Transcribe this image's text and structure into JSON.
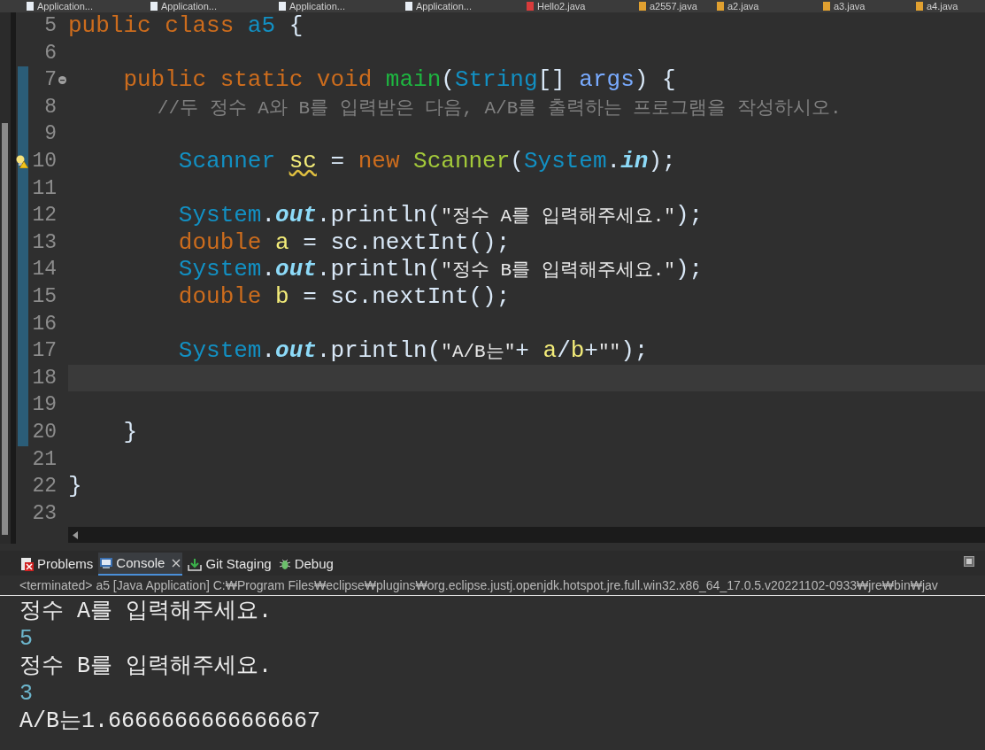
{
  "editor_tabs": [
    {
      "label": "Application...",
      "kind": "app"
    },
    {
      "label": "Application...",
      "kind": "app"
    },
    {
      "label": "Application...",
      "kind": "app"
    },
    {
      "label": "Application...",
      "kind": "app"
    },
    {
      "label": "Hello2.java",
      "kind": "error"
    },
    {
      "label": "a2557.java",
      "kind": "warning"
    },
    {
      "label": "a2.java",
      "kind": "warning"
    },
    {
      "label": "a3.java",
      "kind": "warning"
    },
    {
      "label": "a4.java",
      "kind": "warning"
    }
  ],
  "editor": {
    "lines": [
      {
        "number": "5",
        "changed": false,
        "current": false,
        "fold": false,
        "warning": false,
        "tokens": [
          {
            "text": "public class ",
            "kind": "keyword"
          },
          {
            "text": "a5",
            "kind": "type"
          },
          {
            "text": " {",
            "kind": "plain"
          }
        ]
      },
      {
        "number": "6",
        "changed": false,
        "current": false,
        "fold": false,
        "warning": false
      },
      {
        "number": "7",
        "changed": true,
        "current": false,
        "fold": true,
        "warning": false,
        "tokens": [
          {
            "text": "    public static void ",
            "kind": "keyword"
          },
          {
            "text": "main",
            "kind": "method"
          },
          {
            "text": "(",
            "kind": "plain"
          },
          {
            "text": "String",
            "kind": "type"
          },
          {
            "text": "[] ",
            "kind": "plain"
          },
          {
            "text": "args",
            "kind": "param"
          },
          {
            "text": ") {",
            "kind": "plain"
          }
        ]
      },
      {
        "number": "8",
        "changed": true,
        "current": false,
        "fold": false,
        "warning": false,
        "tokens": [
          {
            "text": "        //두 정수 A와 B를 입력받은 다음, A/B를 출력하는 프로그램을 작성하시오.",
            "kind": "comment"
          }
        ]
      },
      {
        "number": "9",
        "changed": true,
        "current": false,
        "fold": false,
        "warning": false
      },
      {
        "number": "10",
        "changed": true,
        "current": false,
        "fold": false,
        "warning": true,
        "tokens": [
          {
            "text": "        Scanner ",
            "kind": "type"
          },
          {
            "text": "sc",
            "kind": "unused"
          },
          {
            "text": " = ",
            "kind": "plain"
          },
          {
            "text": "new ",
            "kind": "keyword"
          },
          {
            "text": "Scanner",
            "kind": "constructor"
          },
          {
            "text": "(",
            "kind": "plain"
          },
          {
            "text": "System",
            "kind": "type"
          },
          {
            "text": ".",
            "kind": "plain"
          },
          {
            "text": "in",
            "kind": "static"
          },
          {
            "text": ");",
            "kind": "plain"
          }
        ]
      },
      {
        "number": "11",
        "changed": true,
        "current": false,
        "fold": false,
        "warning": false
      },
      {
        "number": "12",
        "changed": true,
        "current": false,
        "fold": false,
        "warning": false,
        "tokens": [
          {
            "text": "        System",
            "kind": "type"
          },
          {
            "text": ".",
            "kind": "plain"
          },
          {
            "text": "out",
            "kind": "static"
          },
          {
            "text": ".println(",
            "kind": "plain"
          },
          {
            "text": "\"정수 A를 입력해주세요.\"",
            "kind": "string"
          },
          {
            "text": ");",
            "kind": "plain"
          }
        ]
      },
      {
        "number": "13",
        "changed": true,
        "current": false,
        "fold": false,
        "warning": false,
        "tokens": [
          {
            "text": "        double ",
            "kind": "keyword"
          },
          {
            "text": "a",
            "kind": "local"
          },
          {
            "text": " = sc.nextInt();",
            "kind": "plain"
          }
        ]
      },
      {
        "number": "14",
        "changed": true,
        "current": false,
        "fold": false,
        "warning": false,
        "tokens": [
          {
            "text": "        System",
            "kind": "type"
          },
          {
            "text": ".",
            "kind": "plain"
          },
          {
            "text": "out",
            "kind": "static"
          },
          {
            "text": ".println(",
            "kind": "plain"
          },
          {
            "text": "\"정수 B를 입력해주세요.\"",
            "kind": "string"
          },
          {
            "text": ");",
            "kind": "plain"
          }
        ]
      },
      {
        "number": "15",
        "changed": true,
        "current": false,
        "fold": false,
        "warning": false,
        "tokens": [
          {
            "text": "        double ",
            "kind": "keyword"
          },
          {
            "text": "b",
            "kind": "local"
          },
          {
            "text": " = sc.nextInt();",
            "kind": "plain"
          }
        ]
      },
      {
        "number": "16",
        "changed": true,
        "current": false,
        "fold": false,
        "warning": false
      },
      {
        "number": "17",
        "changed": true,
        "current": false,
        "fold": false,
        "warning": false,
        "tokens": [
          {
            "text": "        System",
            "kind": "type"
          },
          {
            "text": ".",
            "kind": "plain"
          },
          {
            "text": "out",
            "kind": "static"
          },
          {
            "text": ".println(",
            "kind": "plain"
          },
          {
            "text": "\"A/B는\"",
            "kind": "string"
          },
          {
            "text": "+ ",
            "kind": "plain"
          },
          {
            "text": "a",
            "kind": "local"
          },
          {
            "text": "/",
            "kind": "plain"
          },
          {
            "text": "b",
            "kind": "local"
          },
          {
            "text": "+",
            "kind": "plain"
          },
          {
            "text": "\"\"",
            "kind": "string"
          },
          {
            "text": ");",
            "kind": "plain"
          }
        ]
      },
      {
        "number": "18",
        "changed": true,
        "current": true,
        "fold": false,
        "warning": false
      },
      {
        "number": "19",
        "changed": true,
        "current": false,
        "fold": false,
        "warning": false
      },
      {
        "number": "20",
        "changed": true,
        "current": false,
        "fold": false,
        "warning": false,
        "tokens": [
          {
            "text": "    }",
            "kind": "plain"
          }
        ]
      },
      {
        "number": "21",
        "changed": false,
        "current": false,
        "fold": false,
        "warning": false
      },
      {
        "number": "22",
        "changed": false,
        "current": false,
        "fold": false,
        "warning": false,
        "tokens": [
          {
            "text": "}",
            "kind": "plain"
          }
        ]
      },
      {
        "number": "23",
        "changed": false,
        "current": false,
        "fold": false,
        "warning": false
      }
    ]
  },
  "panel_tabs": [
    {
      "label": "Problems",
      "kind": "problems",
      "selected": false,
      "closable": false
    },
    {
      "label": "Console",
      "kind": "console",
      "selected": true,
      "closable": true
    },
    {
      "label": "Git Staging",
      "kind": "git",
      "selected": false,
      "closable": false
    },
    {
      "label": "Debug",
      "kind": "debug",
      "selected": false,
      "closable": false
    }
  ],
  "console": {
    "status": "<terminated> a5 [Java Application] C:₩Program Files₩eclipse₩plugins₩org.eclipse.justj.openjdk.hotspot.jre.full.win32.x86_64_17.0.5.v20221102-0933₩jre₩bin₩jav",
    "lines": [
      {
        "text": "정수 A를 입력해주세요.",
        "kind": "output"
      },
      {
        "text": "5",
        "kind": "input"
      },
      {
        "text": "정수 B를 입력해주세요.",
        "kind": "output"
      },
      {
        "text": "3",
        "kind": "input"
      },
      {
        "text": "A/B는1.6666666666666667",
        "kind": "output"
      }
    ]
  }
}
